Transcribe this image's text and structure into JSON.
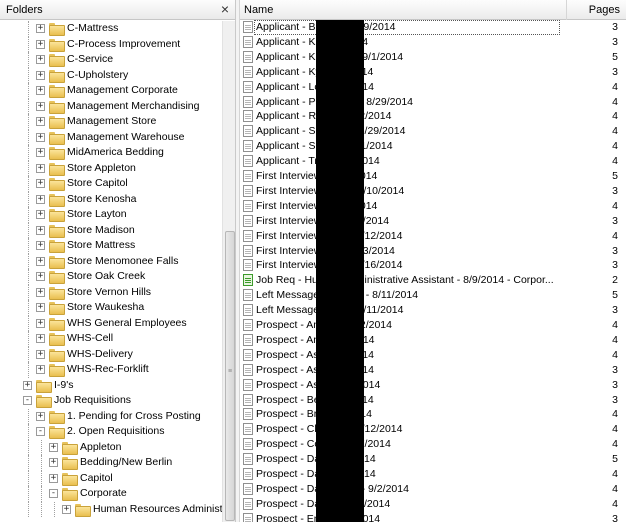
{
  "folders_panel": {
    "title": "Folders",
    "close_glyph": "×",
    "tree": [
      {
        "label": "C-Mattress",
        "depth": 3,
        "expander": "+"
      },
      {
        "label": "C-Process Improvement",
        "depth": 3,
        "expander": "+"
      },
      {
        "label": "C-Service",
        "depth": 3,
        "expander": "+"
      },
      {
        "label": "C-Upholstery",
        "depth": 3,
        "expander": "+"
      },
      {
        "label": "Management Corporate",
        "depth": 3,
        "expander": "+"
      },
      {
        "label": "Management Merchandising",
        "depth": 3,
        "expander": "+"
      },
      {
        "label": "Management Store",
        "depth": 3,
        "expander": "+"
      },
      {
        "label": "Management Warehouse",
        "depth": 3,
        "expander": "+"
      },
      {
        "label": "MidAmerica Bedding",
        "depth": 3,
        "expander": "+"
      },
      {
        "label": "Store Appleton",
        "depth": 3,
        "expander": "+"
      },
      {
        "label": "Store Capitol",
        "depth": 3,
        "expander": "+"
      },
      {
        "label": "Store Kenosha",
        "depth": 3,
        "expander": "+"
      },
      {
        "label": "Store Layton",
        "depth": 3,
        "expander": "+"
      },
      {
        "label": "Store Madison",
        "depth": 3,
        "expander": "+"
      },
      {
        "label": "Store Mattress",
        "depth": 3,
        "expander": "+"
      },
      {
        "label": "Store Menomonee Falls",
        "depth": 3,
        "expander": "+"
      },
      {
        "label": "Store Oak Creek",
        "depth": 3,
        "expander": "+"
      },
      {
        "label": "Store Vernon Hills",
        "depth": 3,
        "expander": "+"
      },
      {
        "label": "Store Waukesha",
        "depth": 3,
        "expander": "+"
      },
      {
        "label": "WHS General Employees",
        "depth": 3,
        "expander": "+"
      },
      {
        "label": "WHS-Cell",
        "depth": 3,
        "expander": "+"
      },
      {
        "label": "WHS-Delivery",
        "depth": 3,
        "expander": "+"
      },
      {
        "label": "WHS-Rec-Forklift",
        "depth": 3,
        "expander": "+"
      },
      {
        "label": "I-9's",
        "depth": 2,
        "expander": "+"
      },
      {
        "label": "Job Requisitions",
        "depth": 2,
        "expander": "-"
      },
      {
        "label": "1. Pending for Cross Posting",
        "depth": 3,
        "expander": "+"
      },
      {
        "label": "2. Open Requisitions",
        "depth": 3,
        "expander": "-"
      },
      {
        "label": "Appleton",
        "depth": 4,
        "expander": "+"
      },
      {
        "label": "Bedding/New Berlin",
        "depth": 4,
        "expander": "+"
      },
      {
        "label": "Capitol",
        "depth": 4,
        "expander": "+"
      },
      {
        "label": "Corporate",
        "depth": 4,
        "expander": "-"
      },
      {
        "label": "Human Resources Administ",
        "depth": 5,
        "expander": "+"
      }
    ]
  },
  "documents_panel": {
    "columns": {
      "name": "Name",
      "pages": "Pages"
    },
    "rows": [
      {
        "name": "Applicant - Bra                ng - 8/29/2014",
        "pages": "3",
        "icon": "document-icon",
        "selected": true
      },
      {
        "name": "Applicant - Kat               /31/2014",
        "pages": "3",
        "icon": "document-icon"
      },
      {
        "name": "Applicant - Kel               owski - 9/1/2014",
        "pages": "5",
        "icon": "document-icon"
      },
      {
        "name": "Applicant - Kyl               - 9/2/2014",
        "pages": "3",
        "icon": "document-icon"
      },
      {
        "name": "Applicant - Lor               - 9/2/2014",
        "pages": "4",
        "icon": "document-icon"
      },
      {
        "name": "Applicant - Par               hester - 8/29/2014",
        "pages": "4",
        "icon": "document-icon"
      },
      {
        "name": "Applicant - Rol               cht - 9/2/2014",
        "pages": "4",
        "icon": "document-icon"
      },
      {
        "name": "Applicant - Sar               glish - 8/29/2014",
        "pages": "4",
        "icon": "document-icon"
      },
      {
        "name": "Applicant - Sar               dt - 8/31/2014",
        "pages": "4",
        "icon": "document-icon"
      },
      {
        "name": "Applicant - Tra               - 8/29/2014",
        "pages": "4",
        "icon": "document-icon"
      },
      {
        "name": "First Interview               - 8/10/2014",
        "pages": "5",
        "icon": "document-icon"
      },
      {
        "name": "First Interview               cCoy - 8/10/2014",
        "pages": "3",
        "icon": "document-icon"
      },
      {
        "name": "First Interview               - 8/10/2014",
        "pages": "4",
        "icon": "document-icon"
      },
      {
        "name": "First Interview               fa - 8/19/2014",
        "pages": "3",
        "icon": "document-icon"
      },
      {
        "name": "First Interview               orski - 8/12/2014",
        "pages": "4",
        "icon": "document-icon"
      },
      {
        "name": "First Interview               ark - 8/13/2014",
        "pages": "3",
        "icon": "document-icon"
      },
      {
        "name": "First Interview               Pree - 8/16/2014",
        "pages": "3",
        "icon": "document-icon"
      },
      {
        "name": "Job Req - Hum               es Administrative Assistant - 8/9/2014 - Corpor...",
        "pages": "2",
        "icon": "green-document-icon"
      },
      {
        "name": "Left Message -                chutten - 8/11/2014",
        "pages": "5",
        "icon": "document-icon"
      },
      {
        "name": "Left Message -                reoli - 8/11/2014",
        "pages": "3",
        "icon": "document-icon"
      },
      {
        "name": "Prospect - Amb               s - 8/12/2014",
        "pages": "4",
        "icon": "document-icon"
      },
      {
        "name": "Prospect - And               8/13/2014",
        "pages": "4",
        "icon": "document-icon"
      },
      {
        "name": "Prospect - Ash               8/15/2014",
        "pages": "4",
        "icon": "document-icon"
      },
      {
        "name": "Prospect - Ash               8/16/2014",
        "pages": "3",
        "icon": "document-icon"
      },
      {
        "name": "Prospect - Ash               - 8/18/2014",
        "pages": "3",
        "icon": "document-icon"
      },
      {
        "name": "Prospect - Bec               8/11/2014",
        "pages": "3",
        "icon": "document-icon"
      },
      {
        "name": "Prospect - Bro               8/11/2014",
        "pages": "4",
        "icon": "document-icon"
      },
      {
        "name": "Prospect - Chri               arts - 8/12/2014",
        "pages": "4",
        "icon": "document-icon"
      },
      {
        "name": "Prospect - Cori               e - 8/27/2014",
        "pages": "4",
        "icon": "document-icon"
      },
      {
        "name": "Prospect - Dan               8/14/2014",
        "pages": "5",
        "icon": "document-icon"
      },
      {
        "name": "Prospect - Dan               8/20/2014",
        "pages": "4",
        "icon": "document-icon"
      },
      {
        "name": "Prospect - Dan               nhardt - 9/2/2014",
        "pages": "4",
        "icon": "document-icon"
      },
      {
        "name": "Prospect - Dan               s - 8/10/2014",
        "pages": "4",
        "icon": "document-icon"
      },
      {
        "name": "Prospect - Emi               - 8/11/2014",
        "pages": "3",
        "icon": "document-icon"
      }
    ]
  },
  "colors": {
    "folder_yellow": "#e9bf4f",
    "job_req_green": "#3c9a2b",
    "redaction": "#000000"
  }
}
